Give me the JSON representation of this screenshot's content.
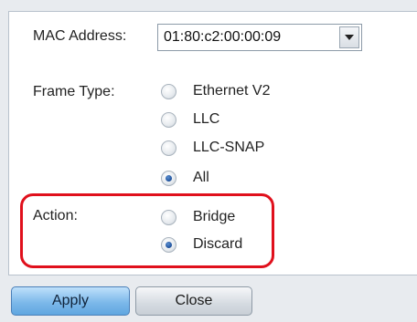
{
  "form": {
    "mac_label": "MAC Address:",
    "mac_value": "01:80:c2:00:00:09",
    "frame_type_label": "Frame Type:",
    "frame_type_options": [
      "Ethernet V2",
      "LLC",
      "LLC-SNAP",
      "All"
    ],
    "frame_type_selected": "All",
    "action_label": "Action:",
    "action_options": [
      "Bridge",
      "Discard"
    ],
    "action_selected": "Discard"
  },
  "buttons": {
    "apply": "Apply",
    "close": "Close"
  },
  "colors": {
    "highlight": "#e0101c",
    "apply_button": "#7db9ea",
    "radio_selected": "#1d4f9a"
  },
  "icons": {
    "mac_dropdown": "caret-down-icon"
  }
}
